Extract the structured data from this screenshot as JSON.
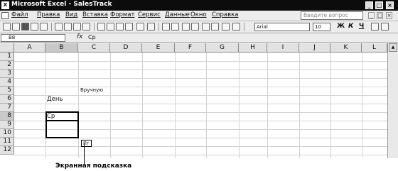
{
  "titlebar": {
    "title": "Microsoft Excel - SalesTrack",
    "icon": "excel-icon",
    "minimize": "_",
    "restore": "□",
    "close": "×"
  },
  "menubar": {
    "items": [
      "Файл",
      "Правка",
      "Вид",
      "Вставка",
      "Формат",
      "Сервис",
      "Данные",
      "Окно",
      "Справка"
    ],
    "help_placeholder": "Введите вопрос",
    "doc_min": "_",
    "doc_restore": "□",
    "doc_close": "×"
  },
  "toolbar": {
    "font": "Arial",
    "size": "10",
    "bold": "Ж",
    "italic": "К",
    "underline": "Ч"
  },
  "formulabar": {
    "namebox": "B8",
    "fx": "fx",
    "value": "Ср"
  },
  "grid": {
    "columns": [
      "A",
      "B",
      "C",
      "D",
      "E",
      "F",
      "G",
      "H",
      "I",
      "J",
      "K",
      "L"
    ],
    "rows": [
      "1",
      "2",
      "3",
      "4",
      "5",
      "6",
      "7",
      "8",
      "9",
      "10",
      "11",
      "12"
    ],
    "cells": {
      "C5": "Вручную",
      "B6": "День",
      "B8": "Ср"
    },
    "tooltip": "Пт"
  },
  "callout": {
    "label": "Экранная подсказка"
  }
}
